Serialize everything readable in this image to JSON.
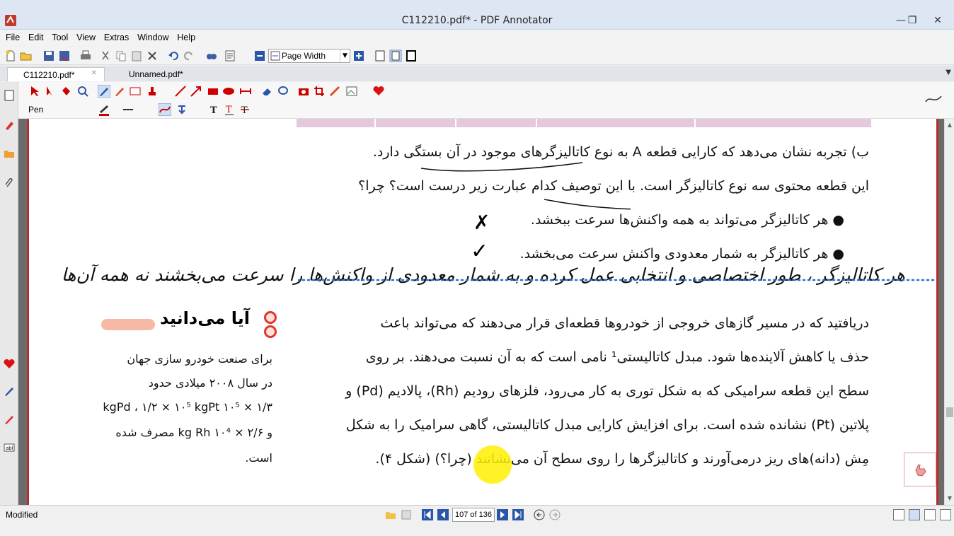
{
  "window": {
    "title": "C112210.pdf* - PDF Annotator",
    "minimize": "—",
    "maximize": "❐",
    "close": "✕"
  },
  "menu": [
    "File",
    "Edit",
    "Tool",
    "View",
    "Extras",
    "Window",
    "Help"
  ],
  "toolbar": {
    "zoom_value": "Page Width"
  },
  "tabs": [
    {
      "label": "C112210.pdf*",
      "close": "✕"
    },
    {
      "label": "Unnamed.pdf*"
    }
  ],
  "tool_options": {
    "tool_name": "Pen"
  },
  "page": {
    "line1": "ب) تجربه نشان می‌دهد که کارایی قطعه A به نوع کاتالیزگرهای موجود در آن بستگی دارد.",
    "line2": "این قطعه محتوی سه نوع کاتالیزگر است. با این توصیف کدام عبارت زیر درست است؟ چرا؟",
    "bullet1": "هر کاتالیزگر می‌تواند به همه واکنش‌ها سرعت ببخشد.",
    "bullet2": "هر کاتالیزگر به شمار معدودی واکنش سرعت می‌بخشد.",
    "mark_x": "✗",
    "mark_check": "✓",
    "handwriting": "هر کاتالیزگر ، طور اختصاصی و انتخابی عمل کرده و به شمار معدودی از واکنش‌ها را سرعت می‌بخشند نه همه آن‌ها",
    "para1": "دریافتید که در مسیر گازهای خروجی از خودروها قطعه‌ای قرار می‌دهند که می‌تواند باعث",
    "para2": "حذف یا کاهش آلاینده‌ها شود. مبدل کاتالیستی¹ نامی است که به آن نسبت می‌دهند. بر روی",
    "para3": "سطح این قطعه سرامیکی که به شکل توری به کار می‌رود، فلزهای رودیم (Rh)، پالادیم (Pd) و",
    "para4": "پلاتین (Pt) نشانده شده است. برای افزایش کارایی مبدل کاتالیستی، گاهی سرامیک را به شکل",
    "para5": "مِش (دانه)های ریز درمی‌آورند و کاتالیزگرها را روی سطح آن می‌نشانند (چرا؟) (شکل ۴).",
    "sidebox_title": "آیا می‌دانید",
    "side1": "برای صنعت خودرو سازی جهان",
    "side2": "در سال ۲۰۰۸ میلادی حدود",
    "side3": "۱/۳ × ۱۰⁵ kgPd ، ۱/۲ × ۱۰⁵ kgPt",
    "side4": "و  ۲/۶ × ۱۰⁴ kg Rh  مصرف شده",
    "side5": "است."
  },
  "status": {
    "text": "Modified",
    "page_indicator": "107 of 136"
  },
  "colors": {
    "page_border": "#b92e28",
    "highlight": "#fff000",
    "title_bg": "#dde6f3"
  }
}
